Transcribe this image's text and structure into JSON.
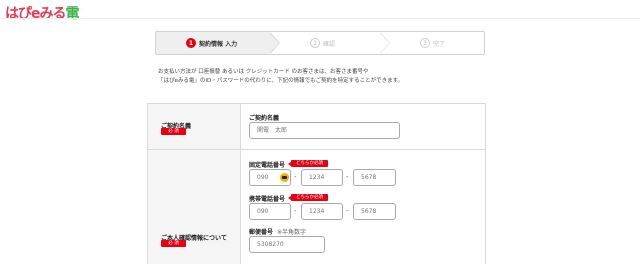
{
  "brand": {
    "logo_main": "はぴeみる",
    "logo_char": "電"
  },
  "steps": [
    {
      "num": "1",
      "label": "契約情報 入力"
    },
    {
      "num": "2",
      "label": "確認"
    },
    {
      "num": "3",
      "label": "完了"
    }
  ],
  "notice": {
    "line1": "お支払い方法が 口座振替 あるいは クレジットカード のお客さまは、お客さま番号や",
    "line2": "「はぴeみる電」のID・パスワードの代わりに、下記の情報でもご契約を特定することができます。"
  },
  "form": {
    "contract_name": {
      "label": "ご契約名義",
      "required": "必 須",
      "field_label": "ご契約名義",
      "placeholder": "関電　太郎"
    },
    "identity": {
      "label": "ご本人確認情報について",
      "required": "必 須",
      "either_badge": "どちらか必須",
      "landline": {
        "label": "固定電話番号",
        "p1": "090",
        "p2": "1234",
        "p3": "5678"
      },
      "mobile": {
        "label": "携帯電話番号",
        "p1": "090",
        "p2": "1234",
        "p3": "5678"
      },
      "postal": {
        "label": "郵便番号",
        "note": "※半角数字",
        "placeholder": "5308270"
      },
      "separator": "-"
    }
  },
  "colors": {
    "accent": "#e60012",
    "brand_pink": "#e73a55",
    "brand_green": "#3bb54a"
  }
}
